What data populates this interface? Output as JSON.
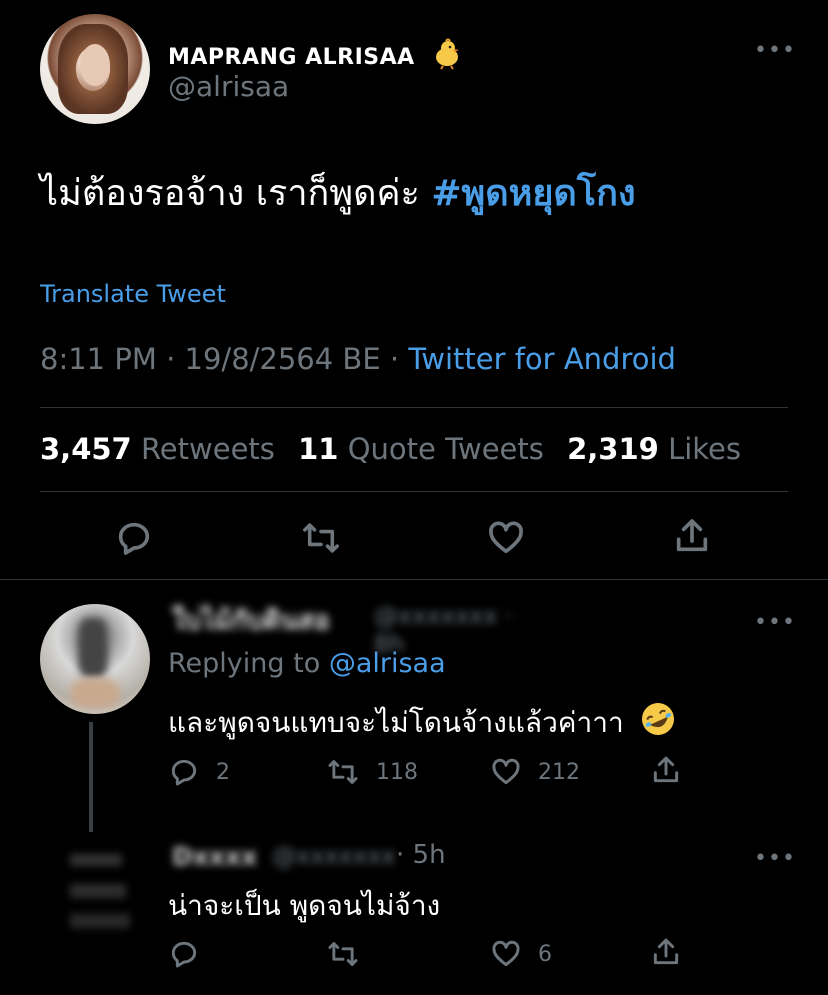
{
  "tweet": {
    "display_name": "MAPRANG ALRISAA",
    "name_emoji": "chick-icon",
    "handle": "@alrisaa",
    "text": "ไม่ต้องรอจ้าง เราก็พูดค่ะ ",
    "hashtag": "#พูดหยุดโกง",
    "translate_label": "Translate Tweet",
    "time": "8:11 PM",
    "date": "19/8/2564 BE",
    "separator": " · ",
    "source": "Twitter for Android",
    "retweets_count": "3,457",
    "retweets_label": "Retweets",
    "quotes_count": "11",
    "quotes_label": "Quote Tweets",
    "likes_count": "2,319",
    "likes_label": "Likes",
    "more": "•••"
  },
  "replies": [
    {
      "name_blurred": "ใบไม้กับดินสอ",
      "handle_time_blurred": "@xxxxxxx · 8h",
      "replying_prefix": "Replying to ",
      "replying_handle": "@alrisaa",
      "text": "และพูดจนแทบจะไม่โดนจ้างแล้วค่าาา",
      "emoji": "rofl-icon",
      "reply_count": "2",
      "retweet_count": "118",
      "like_count": "212",
      "more": "•••"
    },
    {
      "name_blurred": "Dxxxx",
      "handle_blurred": "@xxxxxxx",
      "time": " · 5h",
      "text": "น่าจะเป็น พูดจนไม่จ้าง",
      "reply_count": "",
      "retweet_count": "",
      "like_count": "6",
      "more": "•••"
    }
  ]
}
